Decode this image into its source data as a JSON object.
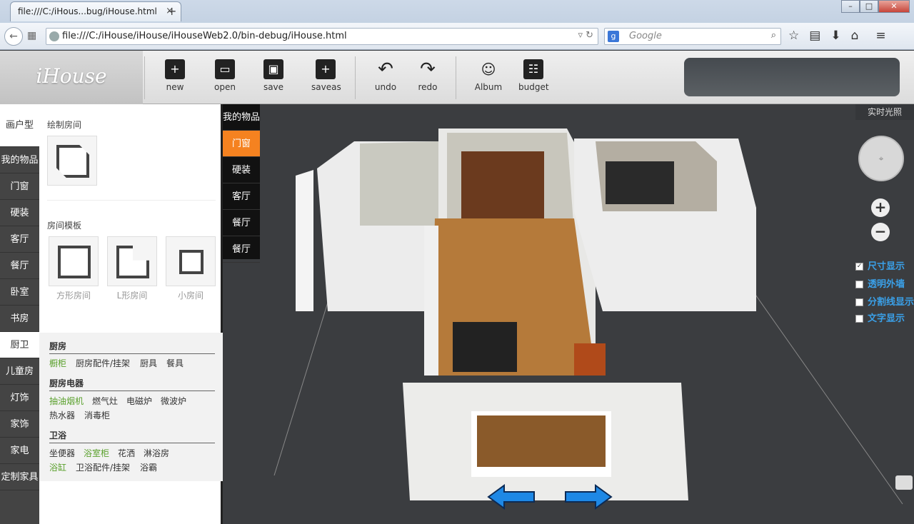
{
  "browser": {
    "tab_title": "file:///C:/iHous...bug/iHouse.html",
    "url": "file:///C:/iHouse/iHouse/iHouseWeb2.0/bin-debug/iHouse.html",
    "search_placeholder": "Google"
  },
  "app": {
    "logo": "iHouse",
    "toolbar": {
      "new": "new",
      "open": "open",
      "save": "save",
      "saveas": "saveas",
      "undo": "undo",
      "redo": "redo",
      "album": "Album",
      "budget": "budget"
    }
  },
  "left_nav": [
    "画户型",
    "我的物品",
    "门窗",
    "硬装",
    "客厅",
    "餐厅",
    "卧室",
    "书房",
    "厨卫",
    "儿童房",
    "灯饰",
    "家饰",
    "家电",
    "定制家具"
  ],
  "panel": {
    "draw_room": "绘制房间",
    "room_templates": "房间模板",
    "templates": [
      "方形房间",
      "L形房间",
      "小房间"
    ],
    "kitchen_header": "厨房",
    "kitchen_items": [
      "橱柜",
      "厨房配件/挂架",
      "厨具",
      "餐具"
    ],
    "appliance_header": "厨房电器",
    "appliance_items": [
      "抽油烟机",
      "燃气灶",
      "电磁炉",
      "微波炉",
      "热水器",
      "消毒柜"
    ],
    "bath_header": "卫浴",
    "bath_items": [
      "坐便器",
      "浴室柜",
      "花洒",
      "淋浴房",
      "浴缸",
      "卫浴配件/挂架",
      "浴霸"
    ]
  },
  "my_items_nav": [
    "我的物品",
    "门窗",
    "硬装",
    "客厅",
    "餐厅",
    "餐厅"
  ],
  "scene": {
    "realtime_light": "实时光照",
    "options": [
      "尺寸显示",
      "透明外墙",
      "分割线显示",
      "文字显示"
    ]
  }
}
